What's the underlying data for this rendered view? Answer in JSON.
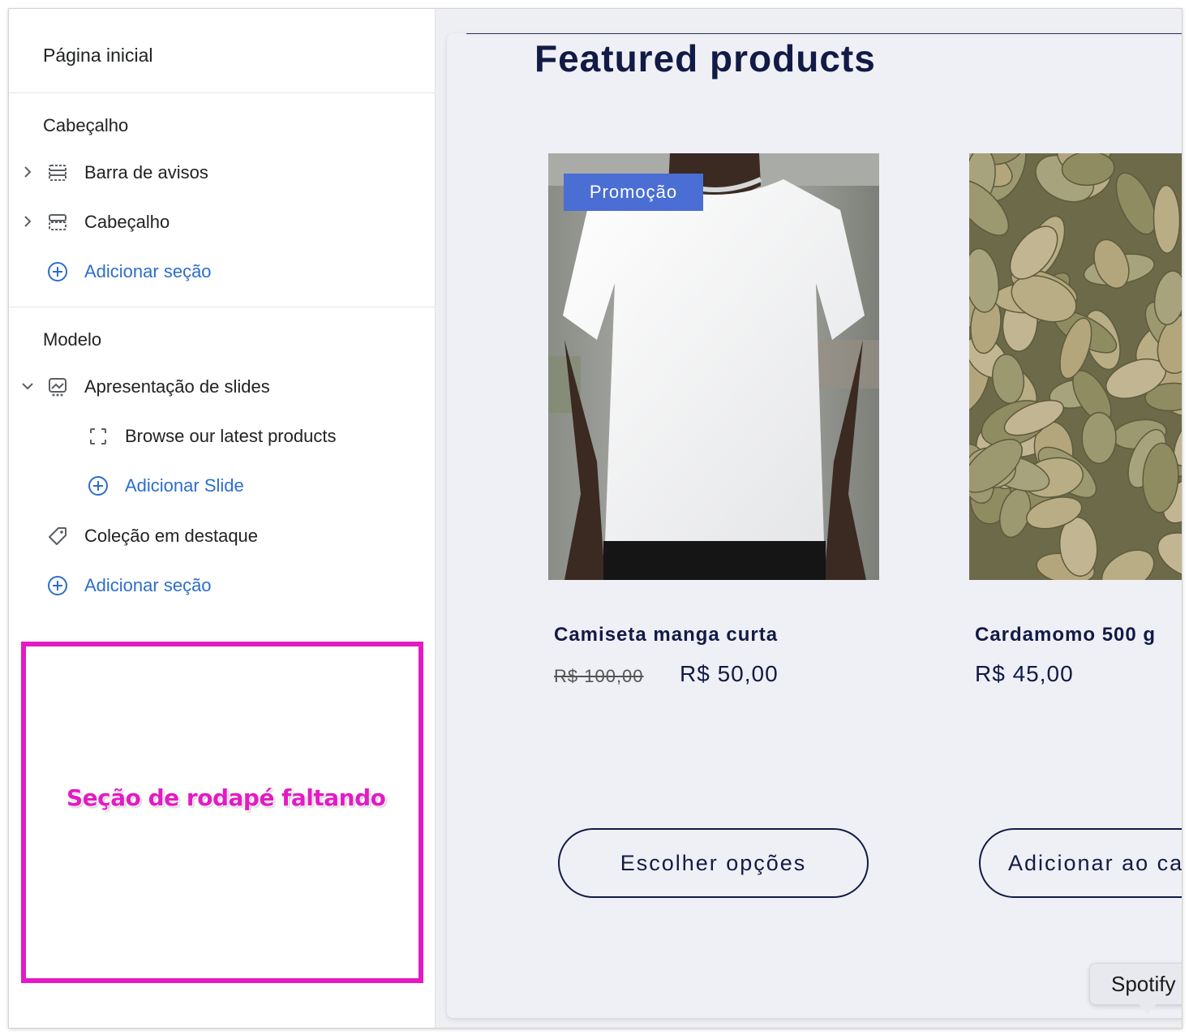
{
  "sidebar": {
    "title": "Página inicial",
    "header_group": {
      "label": "Cabeçalho",
      "items": [
        {
          "label": "Barra de avisos",
          "icon": "announcement-bar-icon"
        },
        {
          "label": "Cabeçalho",
          "icon": "header-layout-icon"
        }
      ],
      "add_section": "Adicionar seção"
    },
    "template_group": {
      "label": "Modelo",
      "slideshow": {
        "label": "Apresentação de slides",
        "icon": "slideshow-icon"
      },
      "slide_item": {
        "label": "Browse our latest products",
        "icon": "slide-frame-icon"
      },
      "add_slide": "Adicionar Slide",
      "featured_collection": {
        "label": "Coleção em destaque",
        "icon": "tag-icon"
      },
      "add_section": "Adicionar seção"
    },
    "missing_footer_note": "Seção de rodapé faltando"
  },
  "preview": {
    "section_title": "Featured products",
    "products": [
      {
        "name": "Camiseta manga curta",
        "badge": "Promoção",
        "old_price": "R$ 100,00",
        "price": "R$ 50,00",
        "button": "Escolher opções"
      },
      {
        "name": "Cardamomo 500 g",
        "price": "R$ 45,00",
        "button": "Adicionar ao ca"
      }
    ],
    "tooltip": "Spotify"
  },
  "colors": {
    "link_blue": "#2c6ecb",
    "highlight_magenta": "#e31bc4",
    "badge_blue": "#4a6ed4",
    "navy": "#121a46"
  }
}
